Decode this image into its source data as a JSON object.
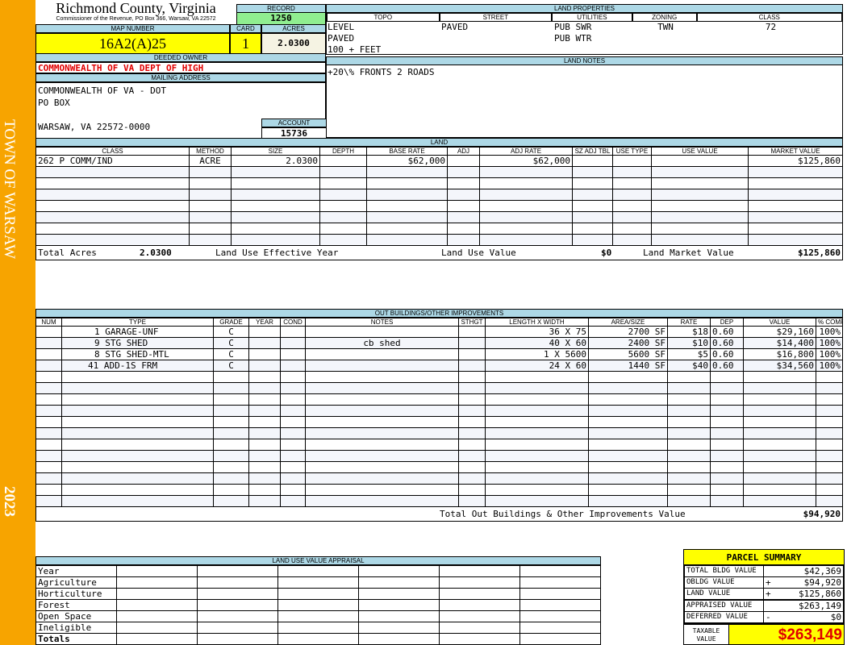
{
  "sidebar": {
    "town": "TOWN OF WARSAW",
    "year": "2023"
  },
  "header": {
    "county": "Richmond County, Virginia",
    "subtitle": "Commissioner of the Revenue, PO Box 366, Warsaw, VA 22572",
    "record_label": "RECORD",
    "record": "1250"
  },
  "parcel": {
    "map_label": "MAP NUMBER",
    "map_number": "16A2(A)25",
    "card_label": "CARD",
    "card": "1",
    "acres_label": "ACRES",
    "acres": "2.0300"
  },
  "owner": {
    "label": "DEEDED OWNER",
    "name": "COMMONWEALTH OF VA DEPT OF HIGH",
    "mailing_label": "MAILING ADDRESS",
    "address": [
      "COMMONWEALTH OF VA - DOT",
      "PO BOX",
      "",
      "WARSAW, VA 22572-0000"
    ],
    "account_label": "ACCOUNT",
    "account": "15736"
  },
  "land_properties": {
    "title": "LAND PROPERTIES",
    "columns": [
      "TOPO",
      "STREET",
      "UTILITIES",
      "ZONING",
      "CLASS"
    ],
    "topo": [
      "LEVEL",
      "PAVED",
      "100 + FEET"
    ],
    "street": "PAVED",
    "utilities": [
      "PUB SWR",
      "PUB WTR"
    ],
    "zoning": "TWN",
    "class": "72"
  },
  "land_notes": {
    "title": "LAND NOTES",
    "text": "+20\\% FRONTS 2 ROADS"
  },
  "land": {
    "title": "LAND",
    "columns": [
      "CLASS",
      "METHOD",
      "SIZE",
      "DEPTH",
      "BASE RATE",
      "ADJ",
      "ADJ RATE",
      "SZ ADJ TBL",
      "USE TYPE",
      "USE VALUE",
      "MARKET VALUE"
    ],
    "rows": [
      [
        "262 P COMM/IND",
        "ACRE",
        "2.0300",
        "",
        "$62,000",
        "",
        "$62,000",
        "",
        "",
        "",
        "$125,860"
      ]
    ],
    "total_acres_label": "Total Acres",
    "total_acres": "2.0300",
    "effective_year_label": "Land Use Effective Year",
    "use_value_label": "Land Use Value",
    "use_value": "$0",
    "market_value_label": "Land Market Value",
    "market_value": "$125,860"
  },
  "outbuildings": {
    "title": "OUT BUILDINGS/OTHER IMPROVEMENTS",
    "columns": [
      "NUM",
      "TYPE",
      "GRADE",
      "YEAR",
      "COND",
      "NOTES",
      "STHGT",
      "LENGTH X WIDTH",
      "AREA/SIZE",
      "RATE",
      "DEP",
      "VALUE",
      "% COMP"
    ],
    "rows": [
      [
        "",
        "1 GARAGE-UNF",
        "C",
        "",
        "",
        "",
        "",
        "36 X 75",
        "2700 SF",
        "$18",
        "0.60",
        "$29,160",
        "100%"
      ],
      [
        "",
        "9 STG SHED",
        "C",
        "",
        "",
        "cb shed",
        "",
        "40 X 60",
        "2400 SF",
        "$10",
        "0.60",
        "$14,400",
        "100%"
      ],
      [
        "",
        "8 STG SHED-MTL",
        "C",
        "",
        "",
        "",
        "",
        "1 X 5600",
        "5600 SF",
        "$5",
        "0.60",
        "$16,800",
        "100%"
      ],
      [
        "",
        "41 ADD-1S FRM",
        "C",
        "",
        "",
        "",
        "",
        "24 X 60",
        "1440 SF",
        "$40",
        "0.60",
        "$34,560",
        "100%"
      ]
    ],
    "total_label": "Total Out Buildings & Other Improvements Value",
    "total": "$94,920"
  },
  "land_use": {
    "title": "LAND USE VALUE APPRAISAL",
    "rows": [
      "Year",
      "Agriculture",
      "Horticulture",
      "Forest",
      "Open Space",
      "Ineligible",
      "Totals"
    ]
  },
  "summary": {
    "title": "PARCEL SUMMARY",
    "rows": [
      {
        "label": "TOTAL BLDG VALUE",
        "sign": "",
        "value": "$42,369"
      },
      {
        "label": "OBLDG VALUE",
        "sign": "+",
        "value": "$94,920"
      },
      {
        "label": "LAND VALUE",
        "sign": "+",
        "value": "$125,860"
      },
      {
        "label": "APPRAISED VALUE",
        "sign": "",
        "value": "$263,149"
      },
      {
        "label": "DEFERRED VALUE",
        "sign": "-",
        "value": "$0"
      }
    ],
    "taxable_label": "TAXABLE VALUE",
    "taxable": "$263,149"
  },
  "colors": {
    "sidebar": "#f7a400",
    "header_bg": "#add8e6",
    "highlight": "#ffff00",
    "record": "#90ee90",
    "owner_text": "#e00000"
  }
}
